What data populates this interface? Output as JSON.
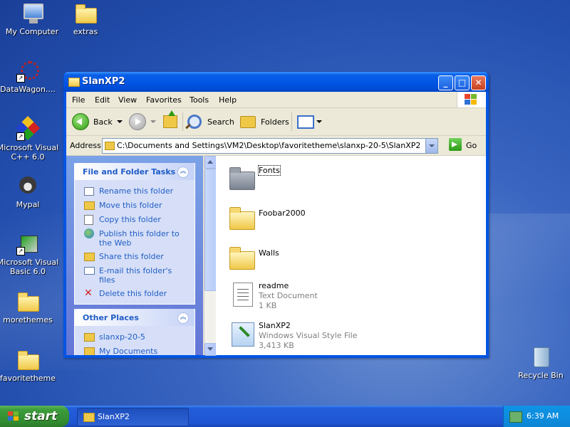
{
  "desktop": {
    "icons": [
      {
        "label": "My Computer"
      },
      {
        "label": "extras"
      },
      {
        "label": "DataWagon...."
      },
      {
        "label": "Microsoft Visual C++ 6.0"
      },
      {
        "label": "Mypal"
      },
      {
        "label": "Microsoft Visual Basic 6.0"
      },
      {
        "label": "morethemes"
      },
      {
        "label": "favoritetheme"
      },
      {
        "label": "Recycle Bin"
      }
    ]
  },
  "window": {
    "title": "SlanXP2",
    "menu": [
      "File",
      "Edit",
      "View",
      "Favorites",
      "Tools",
      "Help"
    ],
    "toolbar": {
      "back": "Back",
      "search": "Search",
      "folders": "Folders"
    },
    "address": {
      "label": "Address",
      "value": "C:\\Documents and Settings\\VM2\\Desktop\\favoritetheme\\slanxp-20-5\\SlanXP2",
      "go": "Go"
    },
    "tasks_panel": {
      "title": "File and Folder Tasks",
      "items": [
        {
          "label": "Rename this folder",
          "icon": "rename-icon"
        },
        {
          "label": "Move this folder",
          "icon": "move-icon"
        },
        {
          "label": "Copy this folder",
          "icon": "copy-icon"
        },
        {
          "label": "Publish this folder to the Web",
          "icon": "publish-web-icon"
        },
        {
          "label": "Share this folder",
          "icon": "share-icon"
        },
        {
          "label": "E-mail this folder's files",
          "icon": "email-icon"
        },
        {
          "label": "Delete this folder",
          "icon": "delete-icon"
        }
      ]
    },
    "other_places": {
      "title": "Other Places",
      "items": [
        {
          "label": "slanxp-20-5",
          "icon": "folder-icon"
        },
        {
          "label": "My Documents",
          "icon": "my-documents-icon"
        }
      ]
    },
    "files": [
      {
        "name": "Fonts",
        "type": "folder",
        "selected": true
      },
      {
        "name": "Foobar2000",
        "type": "folder"
      },
      {
        "name": "Walls",
        "type": "folder"
      },
      {
        "name": "readme",
        "type": "Text Document",
        "size": "1 KB"
      },
      {
        "name": "SlanXP2",
        "type": "Windows Visual Style File",
        "size": "3,413 KB"
      }
    ]
  },
  "taskbar": {
    "start_label": "start",
    "task_button": "SlanXP2",
    "clock": "6:39 AM"
  },
  "colors": {
    "title_blue": "#0054e3",
    "task_link_blue": "#215dc6",
    "start_green": "#3c9c3a"
  }
}
